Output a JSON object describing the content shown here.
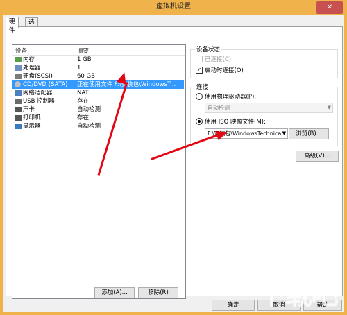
{
  "window": {
    "title": "虚拟机设置",
    "close_glyph": "✕"
  },
  "tabs": [
    {
      "label": "硬件"
    },
    {
      "label": "选项"
    }
  ],
  "device_list": {
    "header": {
      "device": "设备",
      "summary": "摘要"
    },
    "rows": [
      {
        "name": "内存",
        "summary": "1 GB",
        "icon": "memory-icon"
      },
      {
        "name": "处理器",
        "summary": "1",
        "icon": "processor-icon"
      },
      {
        "name": "硬盘(SCSI)",
        "summary": "60 GB",
        "icon": "hard-disk-icon"
      },
      {
        "name": "CD/DVD (SATA)",
        "summary": "正在使用文件 F:\\安装包\\WindowsT...",
        "icon": "cd-dvd-icon"
      },
      {
        "name": "网络适配器",
        "summary": "NAT",
        "icon": "network-adapter-icon"
      },
      {
        "name": "USB 控制器",
        "summary": "存在",
        "icon": "usb-controller-icon"
      },
      {
        "name": "声卡",
        "summary": "自动检测",
        "icon": "sound-card-icon"
      },
      {
        "name": "打印机",
        "summary": "存在",
        "icon": "printer-icon"
      },
      {
        "name": "显示器",
        "summary": "自动检测",
        "icon": "display-icon"
      }
    ],
    "selected_index": 3
  },
  "list_buttons": {
    "add": "添加(A)...",
    "remove": "移除(R)"
  },
  "device_status": {
    "title": "设备状态",
    "connected": "已连接(C)",
    "connect_at_power_on": "启动时连接(O)"
  },
  "connection": {
    "title": "连接",
    "physical_drive": "使用物理驱动器(P):",
    "physical_drive_value": "自动检测",
    "iso_image": "使用 ISO 映像文件(M):",
    "iso_path": "F:\\安装包\\WindowsTechnica",
    "browse": "浏览(B)..."
  },
  "advanced_button": "高级(V)...",
  "footer": {
    "ok": "确定",
    "cancel": "取消",
    "help": "帮助"
  },
  "watermark": "下载吧",
  "colors": {
    "frame": "#f0b24a",
    "selected": "#3399ff",
    "arrow": "#e30613",
    "close": "#c75050"
  }
}
